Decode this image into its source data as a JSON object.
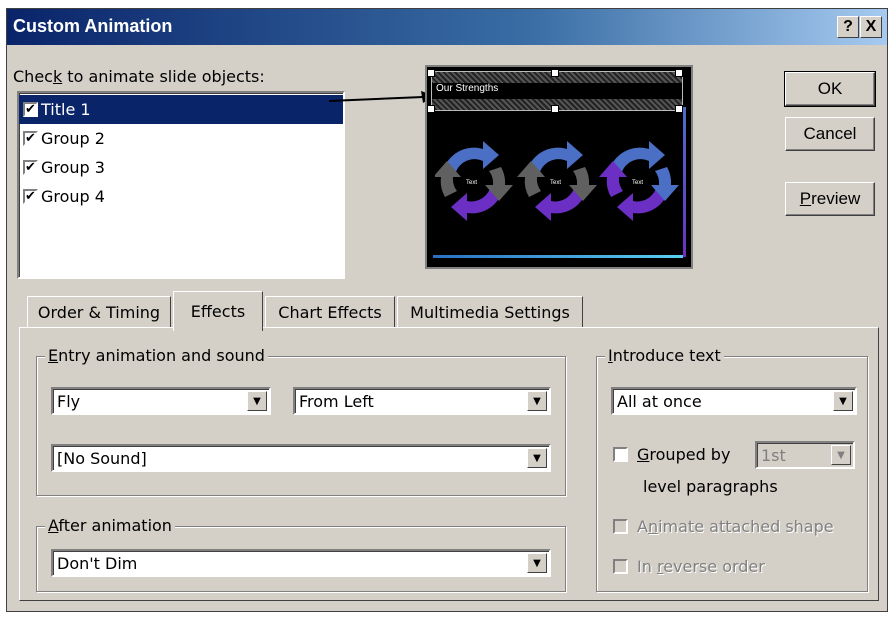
{
  "window": {
    "title": "Custom Animation",
    "help_label": "?",
    "close_label": "X"
  },
  "objects": {
    "label_pre": "Chec",
    "label_key": "k",
    "label_post": " to animate slide objects:",
    "items": [
      {
        "label": "Title 1",
        "checked": true,
        "selected": true
      },
      {
        "label": "Group 2",
        "checked": true,
        "selected": false
      },
      {
        "label": "Group 3",
        "checked": true,
        "selected": false
      },
      {
        "label": "Group 4",
        "checked": true,
        "selected": false
      }
    ]
  },
  "preview_slide": {
    "title_text": "Our Strengths",
    "node_labels": [
      "Text",
      "Text",
      "Text"
    ]
  },
  "buttons": {
    "ok": "OK",
    "cancel": "Cancel",
    "preview_key": "P",
    "preview_rest": "review"
  },
  "tabs": [
    {
      "label": "Order & Timing",
      "active": false
    },
    {
      "label": "Effects",
      "active": true
    },
    {
      "label": "Chart Effects",
      "active": false
    },
    {
      "label": "Multimedia Settings",
      "active": false
    }
  ],
  "entry": {
    "legend_key": "E",
    "legend_rest": "ntry animation and sound",
    "effect": "Fly",
    "direction": "From Left",
    "sound": "[No Sound]"
  },
  "after": {
    "legend_key": "A",
    "legend_rest": "fter animation",
    "value": "Don't Dim"
  },
  "introduce": {
    "legend_key": "I",
    "legend_rest": "ntroduce text",
    "value": "All at once",
    "grouped_key": "G",
    "grouped_rest": "rouped by",
    "grouped_value": "1st",
    "level_paragraphs": "level paragraphs",
    "animate_pre": "A",
    "animate_key": "n",
    "animate_post": "imate attached shape",
    "reverse_pre": "In ",
    "reverse_key": "r",
    "reverse_post": "everse order"
  },
  "colors": {
    "titlebar": "#0a246a",
    "dialog_bg": "#d4d0c8",
    "selection": "#0a246a",
    "slide_bg": "#000000",
    "arrow_blue": "#4a6fc4",
    "arrow_purple": "#6b2fc4",
    "arrow_grey": "#606060"
  }
}
